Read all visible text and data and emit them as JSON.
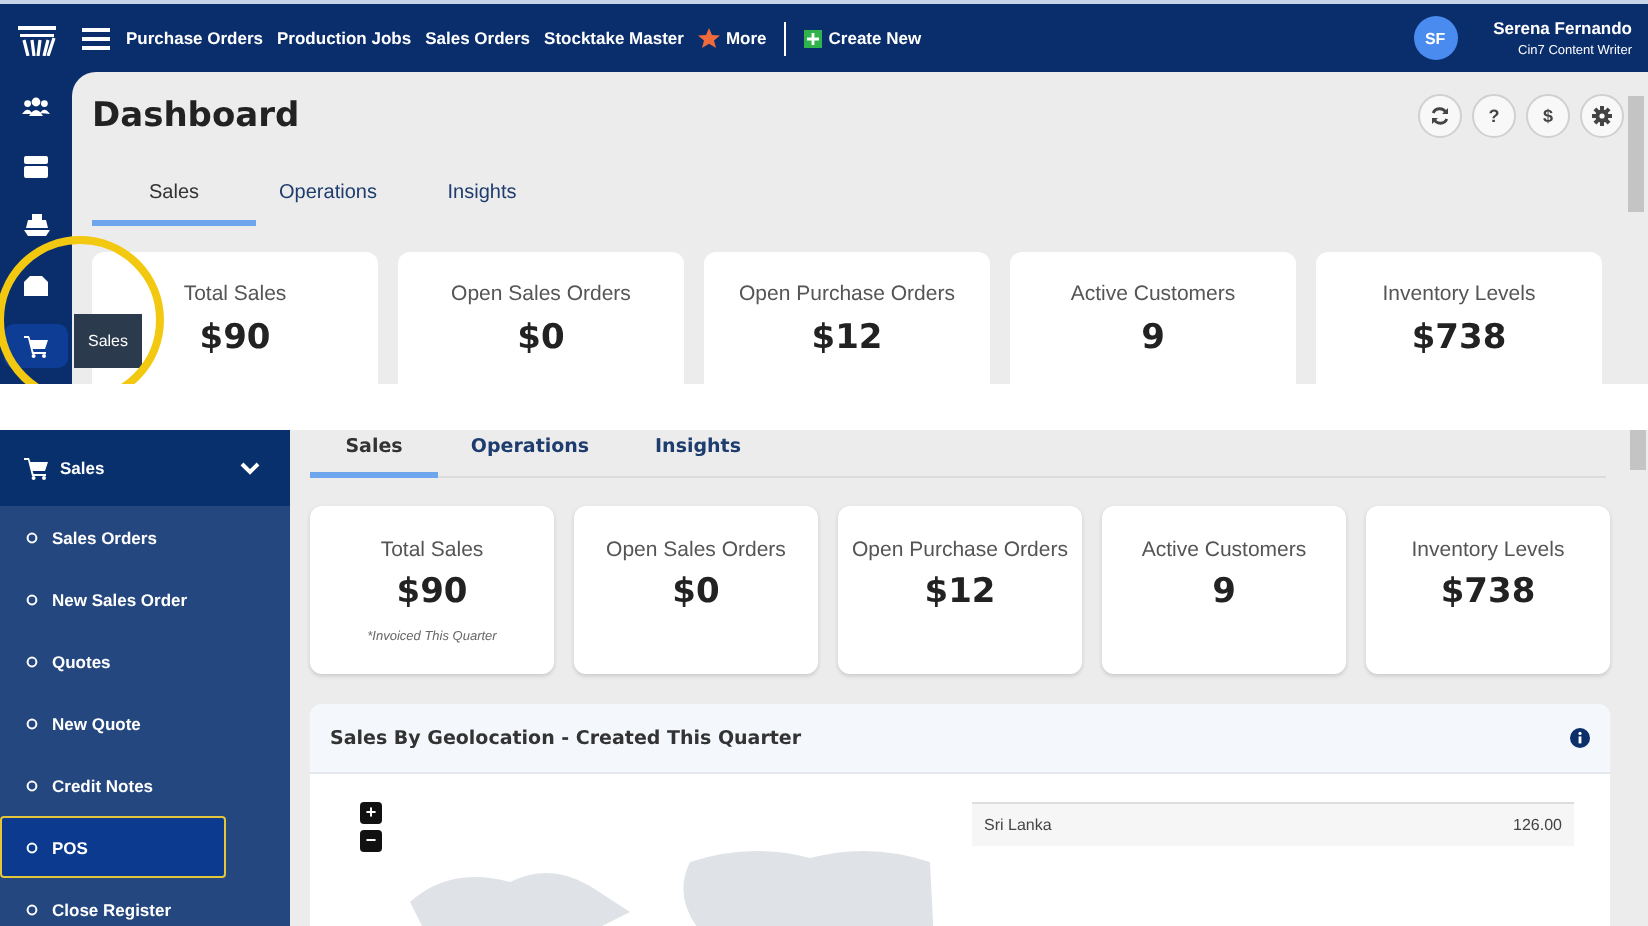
{
  "top_view": {
    "nav": {
      "links": [
        "Purchase Orders",
        "Production Jobs",
        "Sales Orders",
        "Stocktake Master"
      ],
      "more": "More",
      "create": "Create New"
    },
    "user": {
      "initials": "SF",
      "name": "Serena Fernando",
      "role": "Cin7 Content Writer"
    },
    "rail": [
      {
        "kind": "people",
        "selected": false,
        "highlighted": false
      },
      {
        "kind": "box",
        "selected": false,
        "highlighted": false
      },
      {
        "kind": "ship",
        "selected": false,
        "highlighted": false
      },
      {
        "kind": "tray",
        "selected": false,
        "highlighted": false
      },
      {
        "kind": "cart",
        "selected": true,
        "highlighted": true
      }
    ],
    "tooltip": "Sales",
    "title": "Dashboard",
    "actions": [
      {
        "kind": "refresh"
      },
      {
        "kind": "text",
        "label": "?"
      },
      {
        "kind": "text",
        "label": "$"
      },
      {
        "kind": "settings"
      }
    ],
    "tabs": [
      {
        "label": "Sales",
        "selected": true
      },
      {
        "label": "Operations",
        "selected": false
      },
      {
        "label": "Insights",
        "selected": false
      }
    ],
    "cards": [
      {
        "label": "Total Sales",
        "value": "$90"
      },
      {
        "label": "Open Sales Orders",
        "value": "$0"
      },
      {
        "label": "Open Purchase Orders",
        "value": "$12"
      },
      {
        "label": "Active Customers",
        "value": "9"
      },
      {
        "label": "Inventory Levels",
        "value": "$738"
      }
    ]
  },
  "bottom_view": {
    "menu": {
      "title": "Sales",
      "expanded": true,
      "items": [
        {
          "label": "Sales Orders",
          "selected": false,
          "highlighted": false
        },
        {
          "label": "New Sales Order",
          "selected": false,
          "highlighted": false
        },
        {
          "label": "Quotes",
          "selected": false,
          "highlighted": false
        },
        {
          "label": "New Quote",
          "selected": false,
          "highlighted": false
        },
        {
          "label": "Credit Notes",
          "selected": false,
          "highlighted": false
        },
        {
          "label": "POS",
          "selected": true,
          "highlighted": true
        },
        {
          "label": "Close Register",
          "selected": false,
          "highlighted": false
        }
      ]
    },
    "tabs": [
      {
        "label": "Sales",
        "selected": true
      },
      {
        "label": "Operations",
        "selected": false
      },
      {
        "label": "Insights",
        "selected": false
      }
    ],
    "cards": [
      {
        "label": "Total Sales",
        "value": "$90",
        "note": "*Invoiced This Quarter"
      },
      {
        "label": "Open Sales Orders",
        "value": "$0"
      },
      {
        "label": "Open Purchase Orders",
        "value": "$12"
      },
      {
        "label": "Active Customers",
        "value": "9"
      },
      {
        "label": "Inventory Levels",
        "value": "$738"
      }
    ],
    "geo_panel": {
      "title": "Sales By Geolocation - Created This Quarter",
      "zoom_in": "+",
      "zoom_out": "−",
      "rows": [
        {
          "country": "Sri Lanka",
          "value": "126.00"
        }
      ]
    }
  }
}
